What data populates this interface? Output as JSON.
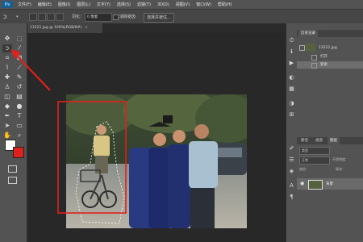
{
  "app": {
    "logo": "Ps"
  },
  "menu": [
    "文件(F)",
    "编辑(E)",
    "图像(I)",
    "图层(L)",
    "文字(Y)",
    "选择(S)",
    "滤镜(T)",
    "3D(D)",
    "视图(V)",
    "窗口(W)",
    "帮助(H)"
  ],
  "options_bar": {
    "feather_label": "羽化：",
    "feather_value": "0 像素",
    "antialias_label": "消除锯齿",
    "select_mask_button": "选择并遮住..."
  },
  "document": {
    "tab_title": "13221.jpg @ 100%(RGB/8#)",
    "close": "×"
  },
  "history_panel": {
    "tab": "历史记录",
    "snapshot_name": "13221.jpg",
    "items": [
      "打开",
      "套索"
    ]
  },
  "layers_panel": {
    "tabs": [
      "路径",
      "通道",
      "图层"
    ],
    "kind_label": "类型",
    "blend_mode": "正常",
    "opacity_label": "不透明度:",
    "lock_label": "锁定:",
    "fill_label": "填充:",
    "layer_name": "背景"
  },
  "colors": {
    "foreground": "#ffffff",
    "background": "#e0201c",
    "annotation": "#e0201c",
    "selected_item": "#6e6e6e"
  },
  "icons": [
    "lasso-icon",
    "move-icon",
    "marquee-icon",
    "magic-wand-icon",
    "crop-icon",
    "eyedropper-icon",
    "healing-brush-icon",
    "brush-icon",
    "clone-stamp-icon",
    "history-brush-icon",
    "eraser-icon",
    "gradient-icon",
    "blur-icon",
    "dodge-icon",
    "pen-icon",
    "type-icon",
    "path-selection-icon",
    "rectangle-icon",
    "hand-icon",
    "zoom-icon",
    "eye-icon"
  ]
}
